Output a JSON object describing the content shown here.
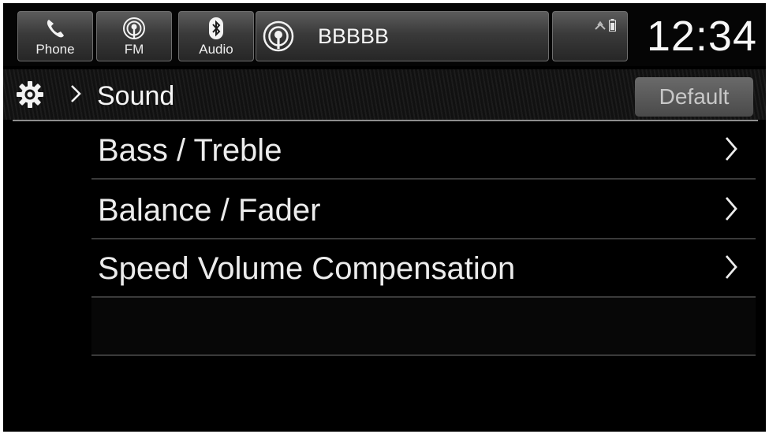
{
  "statusbar": {
    "phone": {
      "label": "Phone",
      "icon": "phone-icon"
    },
    "fm": {
      "label": "FM",
      "icon": "radio-fm-icon",
      "badge": "FM"
    },
    "audio": {
      "label": "Audio",
      "icon": "bluetooth-icon"
    },
    "now_playing": {
      "icon": "radio-fm-icon",
      "badge": "FM",
      "station": "BBBBB"
    },
    "status_icons": [
      "signal-icon",
      "battery-icon"
    ],
    "clock": "12:34"
  },
  "header": {
    "icon": "gear-icon",
    "title": "Sound",
    "default_label": "Default"
  },
  "menu": {
    "items": [
      {
        "label": "Bass / Treble"
      },
      {
        "label": "Balance / Fader"
      },
      {
        "label": "Speed Volume Compensation"
      }
    ]
  },
  "colors": {
    "background": "#000000",
    "text": "#ececec",
    "tile": "#3a3a3a",
    "divider": "#8d8d8d"
  }
}
